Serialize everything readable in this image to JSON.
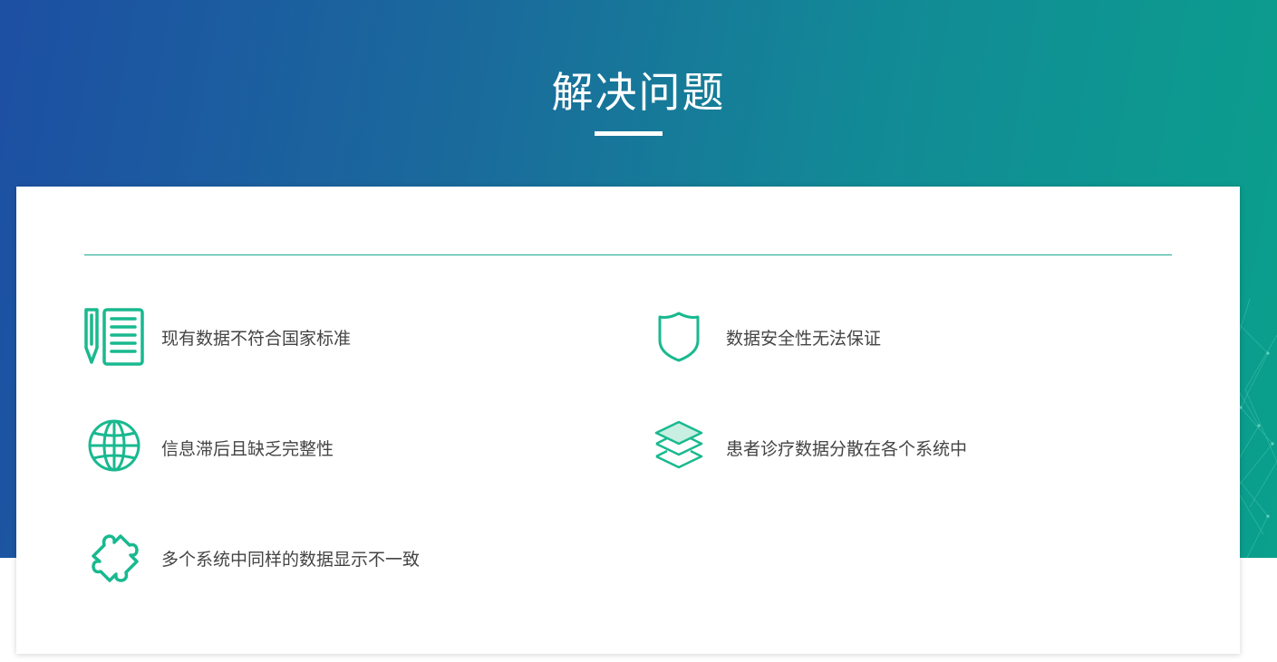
{
  "section": {
    "title": "解决问题"
  },
  "colors": {
    "accent": "#19b98f",
    "gradient_start": "#1d4fa3",
    "gradient_end": "#0aa08c",
    "label_text": "#444444"
  },
  "problems": [
    {
      "label": "现有数据不符合国家标准",
      "icon": "document-pencil-icon"
    },
    {
      "label": "数据安全性无法保证",
      "icon": "shield-icon"
    },
    {
      "label": "信息滞后且缺乏完整性",
      "icon": "globe-icon"
    },
    {
      "label": "患者诊疗数据分散在各个系统中",
      "icon": "layers-icon"
    },
    {
      "label": "多个系统中同样的数据显示不一致",
      "icon": "puzzle-icon"
    }
  ]
}
